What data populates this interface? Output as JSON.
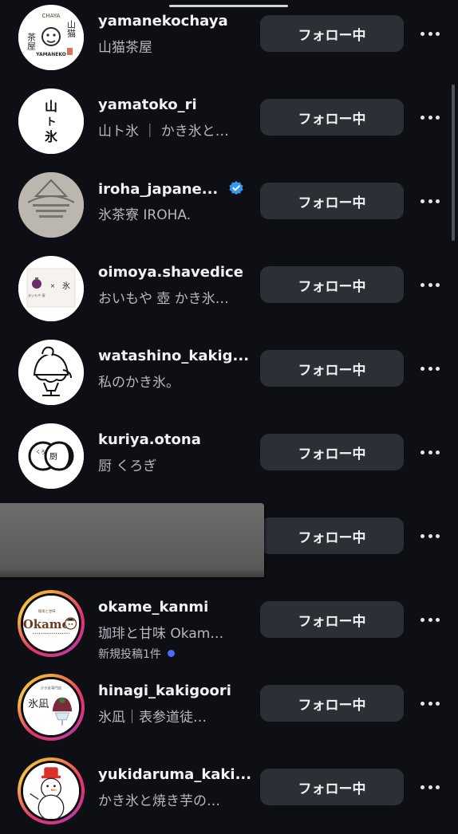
{
  "follow_label": "フォロー中",
  "accounts": [
    {
      "username": "yamanekochaya",
      "subtitle": "山猫茶屋",
      "avatar": "yamanekochaya-logo",
      "verified": false
    },
    {
      "username": "yamatoko_ri",
      "subtitle": "山ト氷 ｜ かき氷と…",
      "avatar": "yamatokori-logo",
      "verified": false
    },
    {
      "username": "iroha_japane...",
      "subtitle": "氷茶寮 IROHA.",
      "avatar": "iroha-logo",
      "verified": true
    },
    {
      "username": "oimoya.shavedice",
      "subtitle": "おいもや 壺 かき氷…",
      "avatar": "oimoya-logo",
      "verified": false
    },
    {
      "username": "watashino_kakig...",
      "subtitle": "私のかき氷。",
      "avatar": "kakigori-illustration",
      "verified": false
    },
    {
      "username": "kuriya.otona",
      "subtitle": "厨 くろぎ",
      "avatar": "kuriya-logo",
      "verified": false
    },
    {
      "username": "",
      "subtitle": "",
      "avatar": "redacted",
      "verified": false
    },
    {
      "username": "okame_kanmi",
      "subtitle": "珈琲と甘味 Okam…",
      "extra": "新規投稿1件",
      "avatar": "okame-logo",
      "verified": false
    },
    {
      "username": "hinagi_kakigoori",
      "subtitle": "氷凪｜表参道徒…",
      "avatar": "hinagi-logo",
      "verified": false
    },
    {
      "username": "yukidaruma_kaki...",
      "subtitle": "かき氷と焼き芋の…",
      "avatar": "snowman-logo",
      "verified": false
    }
  ],
  "avatar_text": {
    "yamanekochaya": {
      "arc": "CHAYA",
      "left": "茶屋",
      "right": "山猫",
      "bottom": "YAMANEKO"
    },
    "yamatokori": {
      "line1": "山",
      "line2": "ト",
      "line3": "氷"
    },
    "oimoya": {
      "mark": "×",
      "kanji": "氷"
    },
    "kuriya": {
      "kanji": "厨"
    },
    "okame": {
      "word": "Okame"
    },
    "hinagi": {
      "kanji": "氷凪"
    }
  },
  "colors": {
    "background": "#0d0f14",
    "button": "#2b2f36",
    "verified": "#3797f0",
    "new_post_dot": "#4b6cf5"
  }
}
